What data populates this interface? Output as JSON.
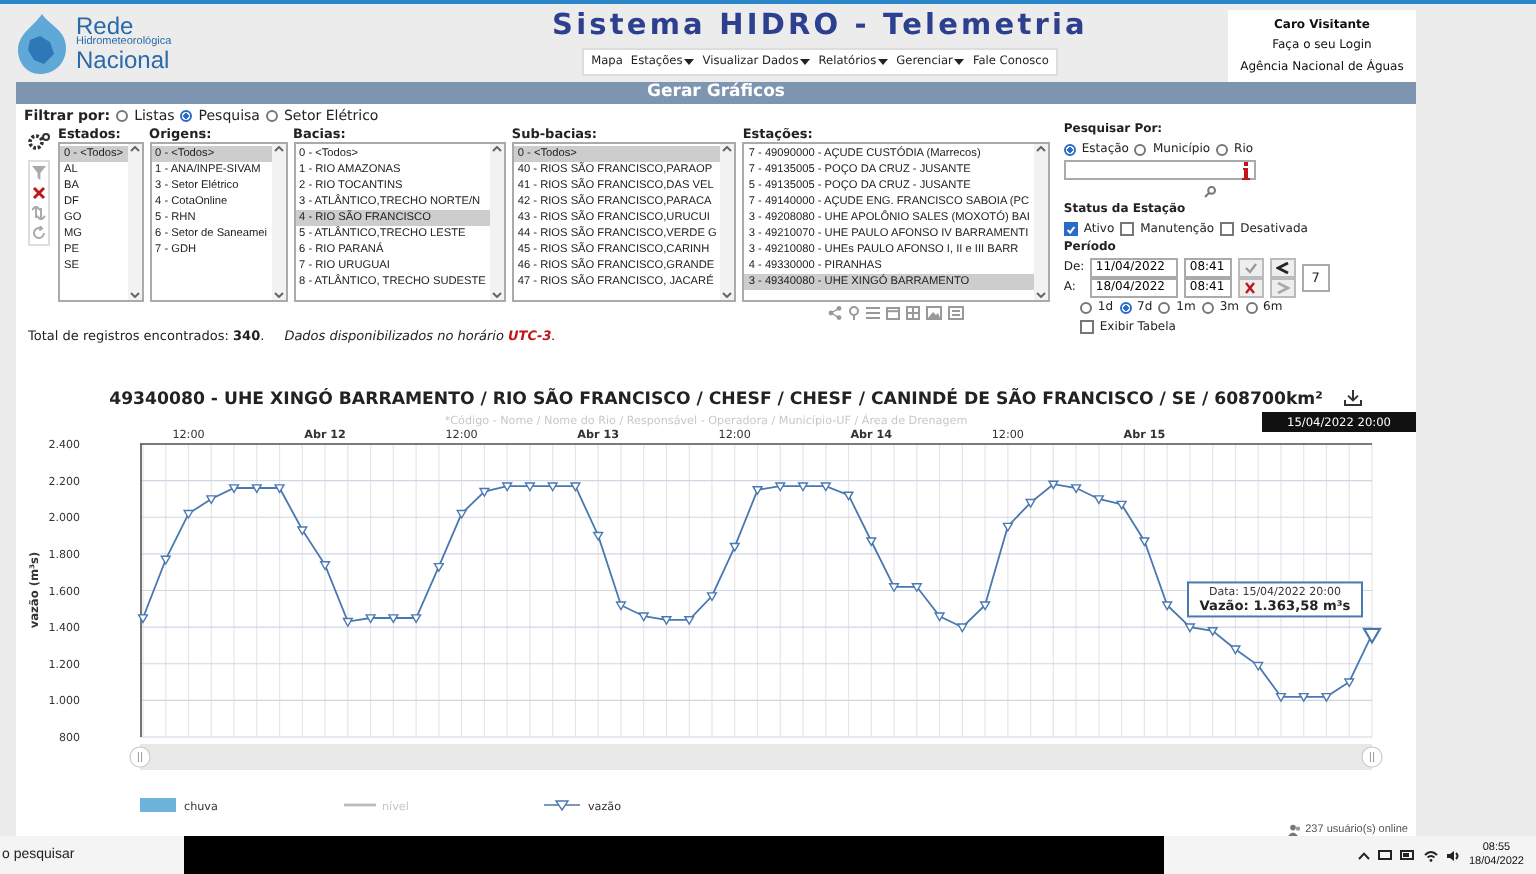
{
  "header": {
    "logo_lines": [
      "Rede",
      "Hidrometeorológica",
      "Nacional"
    ],
    "title": "Sistema HIDRO - Telemetria",
    "nav": [
      {
        "label": "Mapa",
        "dropdown": false
      },
      {
        "label": "Estações",
        "dropdown": true
      },
      {
        "label": "Visualizar Dados",
        "dropdown": true
      },
      {
        "label": "Relatórios",
        "dropdown": true
      },
      {
        "label": "Gerenciar",
        "dropdown": true
      },
      {
        "label": "Fale Conosco",
        "dropdown": false
      }
    ],
    "login": {
      "greeting": "Caro Visitante",
      "link": "Faça o seu Login",
      "agency": "Agência Nacional de Águas"
    }
  },
  "section_title": "Gerar Gráficos",
  "filter_by": {
    "label": "Filtrar por:",
    "options": [
      {
        "label": "Listas",
        "selected": false
      },
      {
        "label": "Pesquisa",
        "selected": true
      },
      {
        "label": "Setor Elétrico",
        "selected": false
      }
    ]
  },
  "lists": [
    {
      "label": "Estados:",
      "items": [
        {
          "text": "0 - <Todos>",
          "selected": true
        },
        {
          "text": "AL",
          "selected": false
        },
        {
          "text": "BA",
          "selected": false
        },
        {
          "text": "DF",
          "selected": false
        },
        {
          "text": "GO",
          "selected": false
        },
        {
          "text": "MG",
          "selected": false
        },
        {
          "text": "PE",
          "selected": false
        },
        {
          "text": "SE",
          "selected": false
        }
      ]
    },
    {
      "label": "Origens:",
      "items": [
        {
          "text": "0 - <Todos>",
          "selected": true
        },
        {
          "text": "1 - ANA/INPE-SIVAM",
          "selected": false
        },
        {
          "text": "3 - Setor Elétrico",
          "selected": false
        },
        {
          "text": "4 - CotaOnline",
          "selected": false
        },
        {
          "text": "5 - RHN",
          "selected": false
        },
        {
          "text": "6 - Setor de Saneamei",
          "selected": false
        },
        {
          "text": "7 - GDH",
          "selected": false
        }
      ]
    },
    {
      "label": "Bacias:",
      "items": [
        {
          "text": "0 - <Todos>",
          "selected": false
        },
        {
          "text": "1 - RIO AMAZONAS",
          "selected": false
        },
        {
          "text": "2 - RIO TOCANTINS",
          "selected": false
        },
        {
          "text": "3 - ATLÂNTICO,TRECHO NORTE/N",
          "selected": false
        },
        {
          "text": "4 - RIO SÃO FRANCISCO",
          "selected": true
        },
        {
          "text": "5 - ATLÂNTICO,TRECHO LESTE",
          "selected": false
        },
        {
          "text": "6 - RIO PARANÁ",
          "selected": false
        },
        {
          "text": "7 - RIO URUGUAI",
          "selected": false
        },
        {
          "text": "8 - ATLÂNTICO, TRECHO SUDESTE",
          "selected": false
        }
      ]
    },
    {
      "label": "Sub-bacias:",
      "items": [
        {
          "text": "0 - <Todos>",
          "selected": true
        },
        {
          "text": "40 - RIOS SÃO FRANCISCO,PARAOP",
          "selected": false
        },
        {
          "text": "41 - RIOS SÃO FRANCISCO,DAS VEL",
          "selected": false
        },
        {
          "text": "42 - RIOS SÃO FRANCISCO,PARACA",
          "selected": false
        },
        {
          "text": "43 - RIOS SÃO FRANCISCO,URUCUI",
          "selected": false
        },
        {
          "text": "44 - RIOS SÃO FRANCISCO,VERDE G",
          "selected": false
        },
        {
          "text": "45 - RIOS SÃO FRANCISCO,CARINH",
          "selected": false
        },
        {
          "text": "46 - RIOS SÃO FRANCISCO,GRANDE",
          "selected": false
        },
        {
          "text": "47 - RIOS SÃO FRANCISCO, JACARÉ",
          "selected": false
        }
      ]
    },
    {
      "label": "Estações:",
      "items": [
        {
          "text": "7 - 49090000 - AÇUDE CUSTÓDIA (Marrecos)",
          "selected": false
        },
        {
          "text": "7 - 49135005 - POÇO DA CRUZ - JUSANTE",
          "selected": false
        },
        {
          "text": "5 - 49135005 - POÇO DA CRUZ - JUSANTE",
          "selected": false
        },
        {
          "text": "7 - 49140000 - AÇUDE ENG. FRANCISCO SABOIA (PC",
          "selected": false
        },
        {
          "text": "3 - 49208080 - UHE APOLÔNIO SALES (MOXOTÓ) BAI",
          "selected": false
        },
        {
          "text": "3 - 49210070 - UHE PAULO AFONSO IV BARRAMENTI",
          "selected": false
        },
        {
          "text": "3 - 49210080 - UHEs PAULO AFONSO I, II e III BARR",
          "selected": false
        },
        {
          "text": "4 - 49330000 - PIRANHAS",
          "selected": false
        },
        {
          "text": "3 - 49340080 - UHE XINGÓ BARRAMENTO",
          "selected": true
        }
      ]
    }
  ],
  "total": "Total de registros encontrados: **340**.",
  "timezone_note": "Dados disponibilizados no horário **UTC-3**.",
  "search": {
    "label": "Pesquisar Por:",
    "options": [
      {
        "label": "Estação",
        "selected": true
      },
      {
        "label": "Município",
        "selected": false
      },
      {
        "label": "Rio",
        "selected": false
      }
    ]
  },
  "status": {
    "label": "Status da Estação",
    "options": [
      {
        "label": "Ativo",
        "checked": true
      },
      {
        "label": "Manutenção",
        "checked": false
      },
      {
        "label": "Desativada",
        "checked": false
      }
    ]
  },
  "period": {
    "label": "Período",
    "from_label": "De:",
    "from_date": "11/04/2022",
    "from_time": "08:41",
    "to_label": "A:",
    "to_date": "18/04/2022",
    "to_time": "08:41",
    "days": "7",
    "ranges": [
      {
        "label": "1d",
        "selected": false
      },
      {
        "label": "7d",
        "selected": true
      },
      {
        "label": "1m",
        "selected": false
      },
      {
        "label": "3m",
        "selected": false
      },
      {
        "label": "6m",
        "selected": false
      }
    ],
    "show_table": {
      "label": "Exibir Tabela",
      "checked": false
    }
  },
  "chart": {
    "subtitle": "*Código - Nome / Nome do Rio / Responsável - Operadora / Município-UF / Área de Drenagem",
    "flag": "15/04/2022 20:00",
    "tooltip": {
      "date": "Data: 15/04/2022 20:00",
      "value": "Vazão: 1.363,58 m³s"
    },
    "legend": [
      {
        "label": "chuva",
        "kind": "bar",
        "color": "#6cb4dc",
        "visible": true
      },
      {
        "label": "nível",
        "kind": "line",
        "color": "#bbbbbb",
        "visible": false
      }
    ],
    "chart_data": {
      "type": "line",
      "title": "49340080 - UHE XINGÓ BARRAMENTO / RIO SÃO FRANCISCO / CHESF / CHESF / CANINDÉ DE SÃO FRANCISCO / SE / 608700km²",
      "ylabel": "vazão (m³s)",
      "categories": [
        null,
        null,
        "12:00",
        null,
        null,
        null,
        null,
        null,
        "Abr 12",
        null,
        null,
        null,
        null,
        null,
        "12:00",
        null,
        null,
        null,
        null,
        null,
        "Abr 13",
        null,
        null,
        null,
        null,
        null,
        "12:00",
        null,
        null,
        null,
        null,
        null,
        "Abr 14",
        null,
        null,
        null,
        null,
        null,
        "12:00",
        null,
        null,
        null,
        null,
        null,
        "Abr 15",
        null,
        null,
        null,
        null,
        null,
        null,
        null,
        null,
        null,
        null
      ],
      "series": [
        {
          "name": "vazão",
          "color": "#4a78b0",
          "marker": "triangle-down",
          "values": [
            1450,
            1770,
            2020,
            2100,
            2160,
            2160,
            2160,
            1930,
            1740,
            1430,
            1450,
            1450,
            1450,
            1730,
            2020,
            2140,
            2170,
            2170,
            2170,
            2170,
            1900,
            1520,
            1460,
            1440,
            1440,
            1570,
            1840,
            2150,
            2170,
            2170,
            2170,
            2120,
            1870,
            1620,
            1620,
            1460,
            1400,
            1520,
            1950,
            2080,
            2180,
            2160,
            2100,
            2070,
            1870,
            1520,
            1400,
            1380,
            1280,
            1190,
            1020,
            1020,
            1020,
            1100,
            1360
          ]
        }
      ],
      "grid": true,
      "ylim": [
        800,
        2400
      ],
      "yticks": [
        {
          "value": 800,
          "label": "800"
        },
        {
          "value": 1000,
          "label": "1.000"
        },
        {
          "value": 1200,
          "label": "1.200"
        },
        {
          "value": 1400,
          "label": "1.400"
        },
        {
          "value": 1600,
          "label": "1.600"
        },
        {
          "value": 1800,
          "label": "1.800"
        },
        {
          "value": 2000,
          "label": "2.000"
        },
        {
          "value": 2200,
          "label": "2.200"
        },
        {
          "value": 2400,
          "label": "2.400"
        }
      ]
    }
  },
  "online_users": "237 usuário(s) online",
  "taskbar": {
    "search": "o pesquisar",
    "time": "08:55",
    "date": "18/04/2022"
  }
}
